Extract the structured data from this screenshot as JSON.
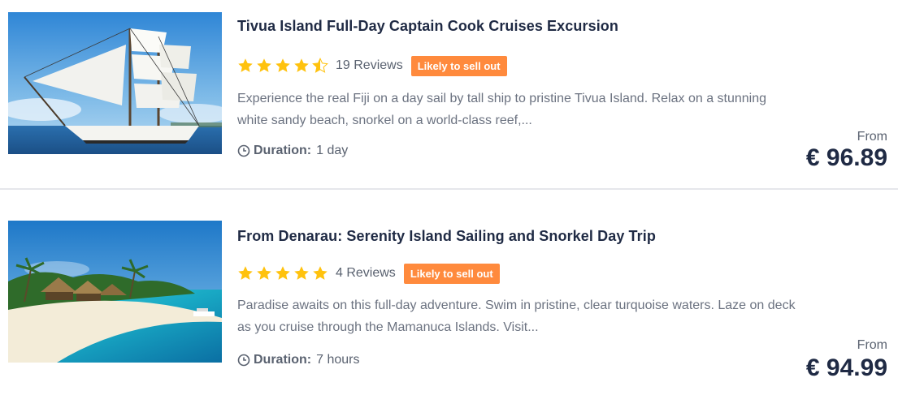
{
  "colors": {
    "title": "#1f2a44",
    "badge": "#ff8a3d",
    "star": "#ffc20e",
    "text_muted": "#6b7280"
  },
  "listings": [
    {
      "title": "Tivua Island Full-Day Captain Cook Cruises Excursion",
      "rating": 4.5,
      "reviews": "19 Reviews",
      "badge": "Likely to sell out",
      "description_lines": [
        "Experience the real Fiji on a day sail by tall ship to pristine Tivua Island. Relax on a stunning",
        "white sandy beach, snorkel on a world-class reef,..."
      ],
      "duration_label": "Duration:",
      "duration_value": "1 day",
      "price_from": "From",
      "price": "€ 96.89",
      "image_icon": "tall-ship-photo"
    },
    {
      "title": "From Denarau: Serenity Island Sailing and Snorkel Day Trip",
      "rating": 5,
      "reviews": "4 Reviews",
      "badge": "Likely to sell out",
      "description_lines": [
        "Paradise awaits on this full-day adventure. Swim in pristine, clear turquoise waters. Laze on deck",
        "as you cruise through the Mamanuca Islands. Visit..."
      ],
      "duration_label": "Duration:",
      "duration_value": "7 hours",
      "price_from": "From",
      "price": "€ 94.99",
      "image_icon": "island-beach-photo"
    }
  ]
}
